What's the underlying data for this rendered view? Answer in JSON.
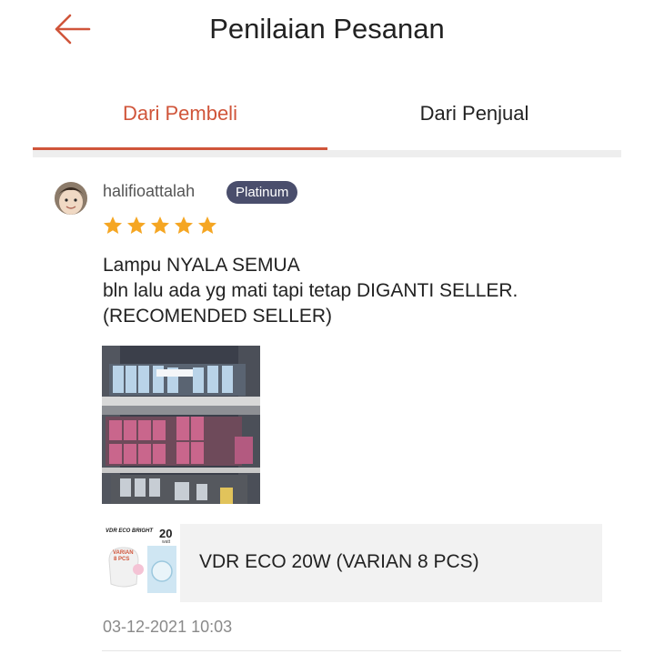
{
  "header": {
    "title": "Penilaian Pesanan",
    "back_icon": "arrow-left-icon",
    "accent_color": "#d0553a"
  },
  "tabs": [
    {
      "label": "Dari Pembeli",
      "active": true
    },
    {
      "label": "Dari Penjual",
      "active": false
    }
  ],
  "review": {
    "username": "halifioattalah",
    "badge": "Platinum",
    "rating": 5,
    "rating_max": 5,
    "star_color": "#f5a623",
    "text_lines": [
      "Lampu NYALA SEMUA",
      "bln lalu ada yg mati tapi tetap DIGANTI SELLER.",
      "(RECOMENDED SELLER)"
    ],
    "product": {
      "name": "VDR ECO 20W (VARIAN 8 PCS)",
      "thumb_brand": "VDR ECO BRIGHT",
      "thumb_watt_number": "20",
      "thumb_watt_unit": "watt",
      "thumb_variant_line1": "VARIAN",
      "thumb_variant_line2": "8 PCS"
    },
    "timestamp": "03-12-2021 10:03"
  }
}
